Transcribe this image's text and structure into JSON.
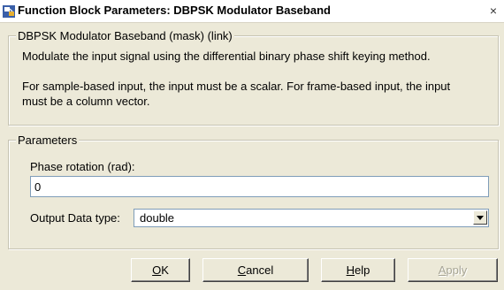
{
  "window": {
    "title": "Function Block Parameters: DBPSK Modulator Baseband",
    "close_glyph": "×"
  },
  "description": {
    "group_label": "DBPSK Modulator Baseband (mask) (link)",
    "line1": "Modulate the input signal using the differential binary phase shift keying method.",
    "line2": "For sample-based input, the input must be a scalar. For frame-based input, the input",
    "line3": "must be a column vector."
  },
  "parameters": {
    "group_label": "Parameters",
    "phase_rotation_label": "Phase rotation (rad):",
    "phase_rotation_value": "0",
    "output_type_label": "Output Data type:",
    "output_type_value": "double"
  },
  "buttons": {
    "ok_mnemonic": "O",
    "ok_rest": "K",
    "cancel_mnemonic": "C",
    "cancel_rest": "ancel",
    "help_mnemonic": "H",
    "help_rest": "elp",
    "apply_mnemonic": "A",
    "apply_rest": "pply"
  },
  "icons": {
    "title": "simulink-block-icon",
    "close": "close-icon",
    "dropdown": "chevron-down-icon"
  }
}
